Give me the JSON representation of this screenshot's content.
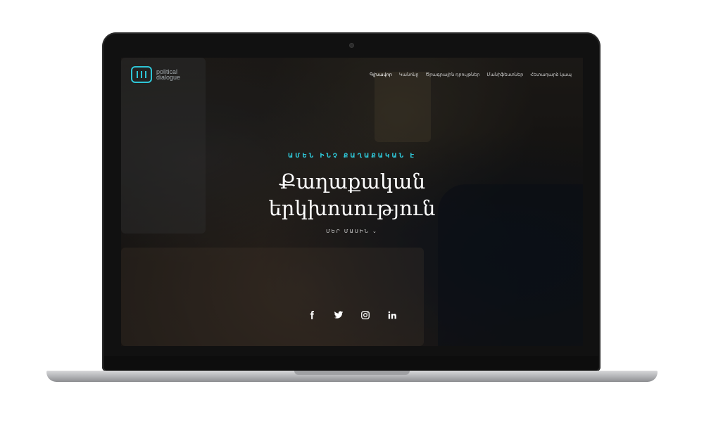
{
  "site": {
    "logo_line1": "political",
    "logo_line2": "dialogue"
  },
  "nav": {
    "items": [
      {
        "label": "Գլխավոր",
        "active": true
      },
      {
        "label": "Կանոնը"
      },
      {
        "label": "Ծրագրային դրույթներ"
      },
      {
        "label": "Մանիֆեստներ"
      },
      {
        "label": "Հետադարձ կապ"
      }
    ]
  },
  "hero": {
    "tagline": "ԱՄԵՆ ԻՆՉ ՔԱՂԱՔԱԿԱՆ Է",
    "title_line1": "Քաղաքական",
    "title_line2": "երկխոսություն",
    "about": "ՄԵՐ ՄԱՍԻՆ"
  },
  "social": [
    "facebook-icon",
    "twitter-icon",
    "instagram-icon",
    "linkedin-icon"
  ],
  "colors": {
    "accent": "#2ec5d6",
    "text": "#ffffff"
  }
}
